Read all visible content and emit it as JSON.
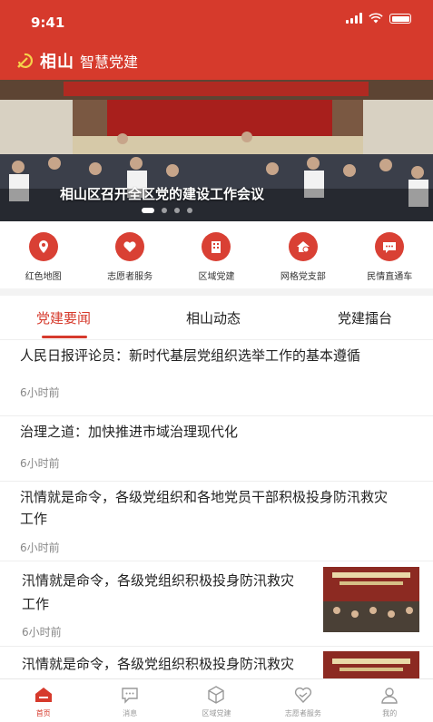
{
  "status": {
    "time": "9:41"
  },
  "header": {
    "brand_main": "相山",
    "brand_sub": "智慧党建"
  },
  "banner": {
    "caption": "相山区召开全区党的建设工作会议",
    "slide_count": 4,
    "active_slide": 1
  },
  "quick_links": [
    {
      "label": "红色地图",
      "icon": "map-pin-icon"
    },
    {
      "label": "志愿者服务",
      "icon": "heart-icon"
    },
    {
      "label": "区域党建",
      "icon": "building-icon"
    },
    {
      "label": "网格党支部",
      "icon": "home-icon"
    },
    {
      "label": "民情直通车",
      "icon": "chat-icon"
    }
  ],
  "tabs": [
    {
      "label": "党建要闻",
      "active": true
    },
    {
      "label": "相山动态",
      "active": false
    },
    {
      "label": "党建擂台",
      "active": false
    }
  ],
  "news": [
    {
      "lines": [
        "人民日报评论员：新时代基层党组织选举工作的基本遵循"
      ],
      "time": "6小时前",
      "has_thumb": false
    },
    {
      "lines": [
        "治理之道：加快推进市域治理现代化"
      ],
      "time": "6小时前",
      "has_thumb": false
    },
    {
      "lines": [
        "汛情就是命令，各级党组织和各地党员干部积极投身防汛救灾",
        "工作"
      ],
      "time": "6小时前",
      "has_thumb": false
    },
    {
      "lines": [
        "汛情就是命令，各级党组织积极投身防汛救灾",
        "工作"
      ],
      "time": "6小时前",
      "has_thumb": true
    },
    {
      "lines": [
        "汛情就是命令，各级党组织积极投身防汛救灾"
      ],
      "time": "",
      "has_thumb": true
    }
  ],
  "tabbar": [
    {
      "label": "首页",
      "icon": "home-icon",
      "active": true
    },
    {
      "label": "消息",
      "icon": "message-icon",
      "active": false
    },
    {
      "label": "区域党建",
      "icon": "cube-icon",
      "active": false
    },
    {
      "label": "志愿者服务",
      "icon": "heart-icon",
      "active": false
    },
    {
      "label": "我的",
      "icon": "user-icon",
      "active": false
    }
  ],
  "colors": {
    "brand": "#d63a2c",
    "muted": "#888888"
  }
}
